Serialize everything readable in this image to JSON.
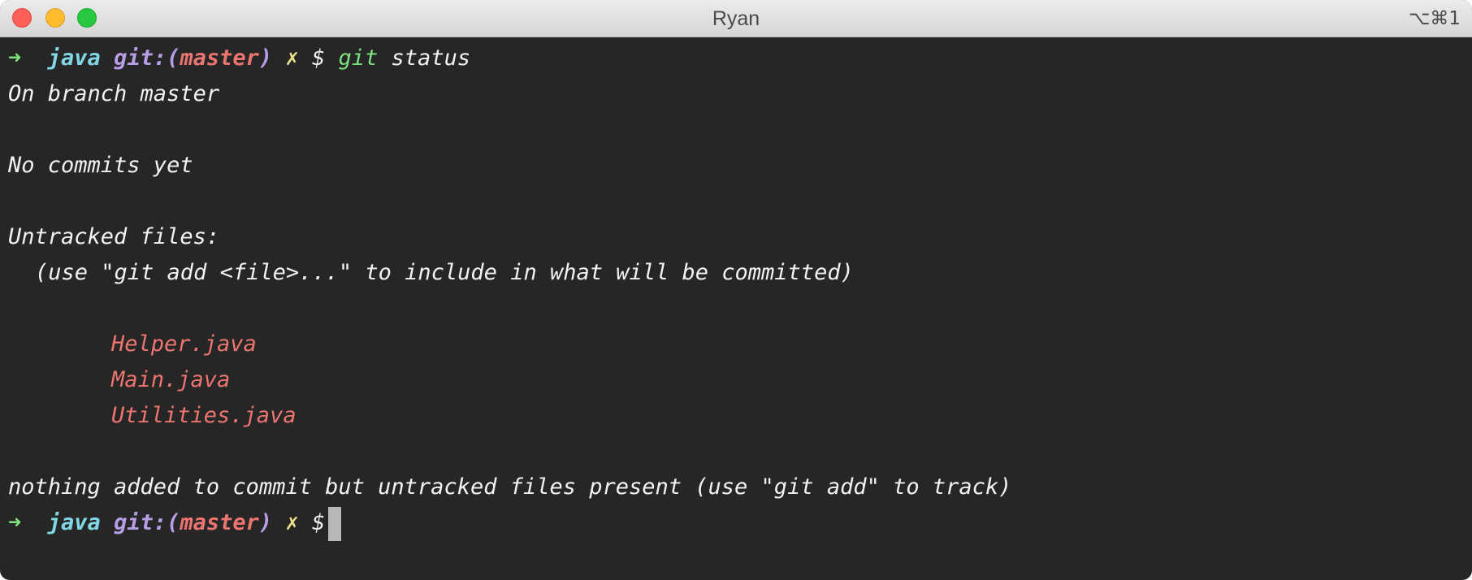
{
  "window": {
    "title": "Ryan",
    "shortcut": "⌥⌘1"
  },
  "prompt": {
    "arrow": "➜",
    "directory": "java",
    "git_prefix": "git:(",
    "branch": "master",
    "git_suffix": ")",
    "dirty_mark": "✗",
    "symbol": "$"
  },
  "command": {
    "program": "git",
    "args": "status"
  },
  "output": {
    "on_branch": "On branch master",
    "no_commits": "No commits yet",
    "untracked_header": "Untracked files:",
    "untracked_hint": "(use \"git add <file>...\" to include in what will be committed)",
    "untracked_files": [
      "Helper.java",
      "Main.java",
      "Utilities.java"
    ],
    "summary": "nothing added to commit but untracked files present (use \"git add\" to track)"
  },
  "colors": {
    "background": "#262626",
    "arrow": "#7ee27e",
    "directory": "#80d8e6",
    "git_label": "#b79ee6",
    "branch": "#ed7570",
    "dirty_mark": "#ece289",
    "untracked_file": "#ed7570"
  }
}
